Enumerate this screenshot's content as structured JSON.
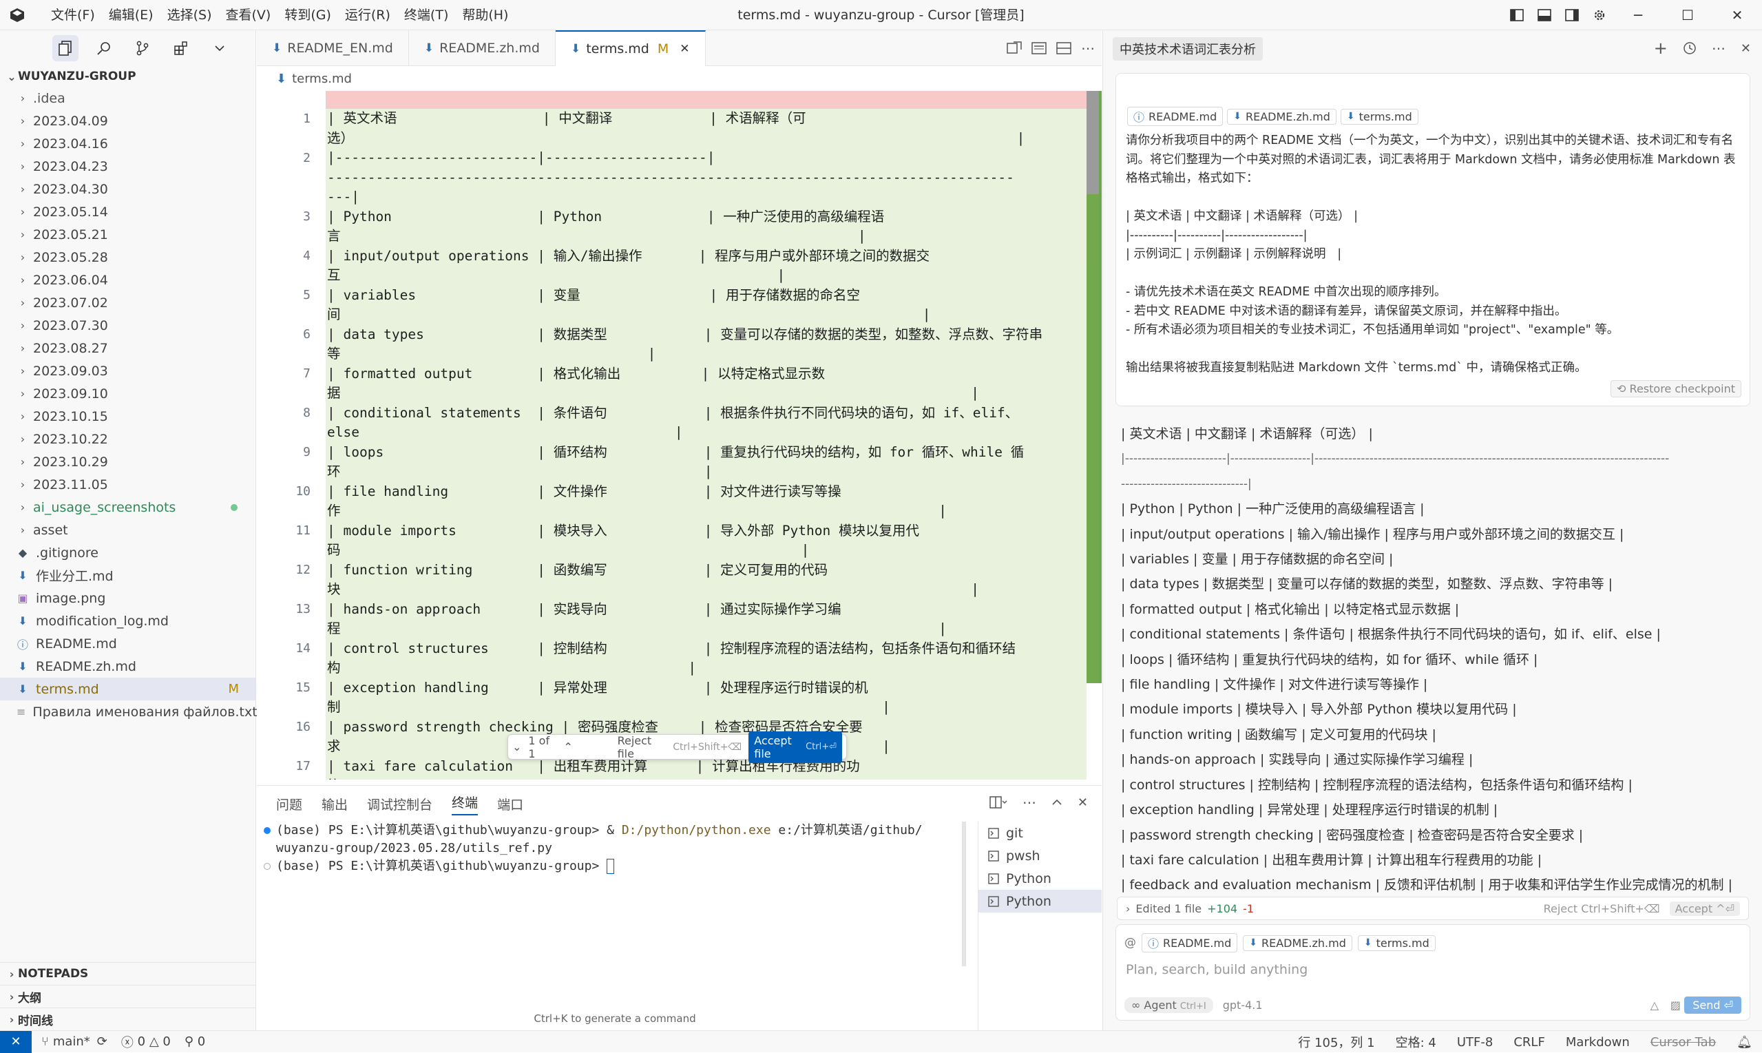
{
  "window": {
    "title": "terms.md - wuyanzu-group - Cursor [管理员]",
    "menus": [
      "文件(F)",
      "编辑(E)",
      "选择(S)",
      "查看(V)",
      "转到(G)",
      "运行(R)",
      "终端(T)",
      "帮助(H)"
    ],
    "controls": {
      "minimize": "─",
      "maximize": "☐",
      "close": "✕"
    }
  },
  "sidebar": {
    "root": "WUYANZU-GROUP",
    "items": [
      {
        "label": ".idea",
        "type": "folder"
      },
      {
        "label": "2023.04.09",
        "type": "folder"
      },
      {
        "label": "2023.04.16",
        "type": "folder"
      },
      {
        "label": "2023.04.23",
        "type": "folder"
      },
      {
        "label": "2023.04.30",
        "type": "folder"
      },
      {
        "label": "2023.05.14",
        "type": "folder"
      },
      {
        "label": "2023.05.21",
        "type": "folder"
      },
      {
        "label": "2023.05.28",
        "type": "folder"
      },
      {
        "label": "2023.06.04",
        "type": "folder"
      },
      {
        "label": "2023.07.02",
        "type": "folder"
      },
      {
        "label": "2023.07.30",
        "type": "folder"
      },
      {
        "label": "2023.08.27",
        "type": "folder"
      },
      {
        "label": "2023.09.03",
        "type": "folder"
      },
      {
        "label": "2023.09.10",
        "type": "folder"
      },
      {
        "label": "2023.10.15",
        "type": "folder"
      },
      {
        "label": "2023.10.22",
        "type": "folder"
      },
      {
        "label": "2023.10.29",
        "type": "folder"
      },
      {
        "label": "2023.11.05",
        "type": "folder"
      },
      {
        "label": "ai_usage_screenshots",
        "type": "folder"
      },
      {
        "label": "asset",
        "type": "folder"
      },
      {
        "label": ".gitignore",
        "type": "file"
      },
      {
        "label": "作业分工.md",
        "type": "file"
      },
      {
        "label": "image.png",
        "type": "file"
      },
      {
        "label": "modification_log.md",
        "type": "file"
      },
      {
        "label": "README.md",
        "type": "file"
      },
      {
        "label": "README.zh.md",
        "type": "file"
      },
      {
        "label": "terms.md",
        "type": "file",
        "badge": "M"
      },
      {
        "label": "Правила именования файлов.txt",
        "type": "file"
      }
    ],
    "sections": [
      "NOTEPADS",
      "大纲",
      "时间线"
    ],
    "colors": {
      "untracked": "#2e8b57",
      "modified": "#b58a00",
      "selected": "#e4e6f1"
    }
  },
  "tabs": [
    {
      "label": "README_EN.md",
      "modified": ""
    },
    {
      "label": "README.zh.md",
      "modified": ""
    },
    {
      "label": "terms.md",
      "modified": "M"
    }
  ],
  "breadcrumb": "terms.md",
  "editor": {
    "line_numbers": [
      "1",
      "2",
      "3",
      "4",
      "5",
      "6",
      "7",
      "8",
      "9",
      "10",
      "11",
      "12",
      "13",
      "14",
      "15",
      "16",
      "17"
    ],
    "code": "| 英文术语                  | 中文翻译            | 术语解释（可\n选）                                                                                  |\n|-------------------------|--------------------|\n-------------------------------------------------------------------------------------\n---|\n| Python                  | Python             | 一种广泛使用的高级编程语\n言                                                                |\n| input/output operations | 输入/输出操作       | 程序与用户或外部环境之间的数据交\n互                                                      |\n| variables               | 变量                | 用于存储数据的命名空\n间                                                                        |\n| data types              | 数据类型            | 变量可以存储的数据的类型，如整数、浮点数、字符串\n等                                      |\n| formatted output        | 格式化输出          | 以特定格式显示数\n据                                                                              |\n| conditional statements  | 条件语句            | 根据条件执行不同代码块的语句，如 if、elif、\nelse                                       |\n| loops                   | 循环结构            | 重复执行代码块的结构，如 for 循环、while 循\n环                                             |\n| file handling           | 文件操作            | 对文件进行读写等操\n作                                                                          |\n| module imports          | 模块导入            | 导入外部 Python 模块以复用代\n码                                                         |\n| function writing        | 函数编写            | 定义可复用的代码\n块                                                                              |\n| hands-on approach       | 实践导向            | 通过实际操作学习编\n程                                                                          |\n| control structures      | 控制结构            | 控制程序流程的语法结构，包括条件语句和循环结\n构                                           |\n| exception handling      | 异常处理            | 处理程序运行时错误的机\n制                                                                   |\n| password strength checking | 密码强度检查     | 检查密码是否符合安全要\n求                                                                   |\n| taxi fare calculation   | 出租车费用计算      | 计算出租车行程费用的功\n能                                                                   |",
    "float_bar": {
      "counter": "1 of 1",
      "reject": "Reject file",
      "reject_key": "Ctrl+Shift+⌫",
      "accept": "Accept file",
      "accept_key": "Ctrl+⏎"
    }
  },
  "panel": {
    "tabs": [
      "问题",
      "输出",
      "调试控制台",
      "终端",
      "端口"
    ],
    "active_tab": "终端",
    "terminal": {
      "line1_prompt": "(base) PS E:\\计算机英语\\github\\wuyanzu-group> & ",
      "line1_path": "D:/python/python.exe",
      "line1_rest": " e:/计算机英语/github/",
      "line2": "wuyanzu-group/2023.05.28/utils_ref.py",
      "line3": "(base) PS E:\\计算机英语\\github\\wuyanzu-group> "
    },
    "terminal_list": [
      "git",
      "pwsh",
      "Python",
      "Python"
    ],
    "hint": "Ctrl+K to generate a command"
  },
  "chat": {
    "title": "中英技术术语词汇表分析",
    "context_pills": [
      "README.md",
      "README.zh.md",
      "terms.md"
    ],
    "prompt": "请你分析我项目中的两个 README 文档（一个为英文，一个为中文），识别出其中的关键术语、技术词汇和专有名词。将它们整理为一个中英对照的术语词汇表，词汇表将用于 Markdown 文档中，请务必使用标准 Markdown 表格格式输出，格式如下：\n\n| 英文术语 | 中文翻译 | 术语解释（可选） |\n|----------|----------|------------------|\n| 示例词汇 | 示例翻译 | 示例解释说明   |\n\n- 请优先技术术语在英文 README 中首次出现的顺序排列。\n- 若中文 README 中对该术语的翻译有差异，请保留英文原词，并在解释中指出。\n- 所有术语必须为项目相关的专业技术词汇，不包括通用单词如 \"project\"、\"example\" 等。\n\n输出结果将被我直接复制粘贴进 Markdown 文件 `terms.md` 中，请确保格式正确。",
    "restore": "Restore checkpoint",
    "answer_header": "| 英文术语 | 中文翻译 | 术语解释（可选） |",
    "answer_sep1": "|------------------------|-------------------|------------------------------------------------------------------------------------",
    "answer_sep2": "------------------------------|",
    "answer_rows": [
      "| Python | Python | 一种广泛使用的高级编程语言 |",
      "| input/output operations | 输入/输出操作 | 程序与用户或外部环境之间的数据交互 |",
      "| variables | 变量 | 用于存储数据的命名空间 |",
      "| data types | 数据类型 | 变量可以存储的数据的类型，如整数、浮点数、字符串等 |",
      "| formatted output | 格式化输出 | 以特定格式显示数据 |",
      "| conditional statements | 条件语句 | 根据条件执行不同代码块的语句，如 if、elif、else |",
      "| loops | 循环结构 | 重复执行代码块的结构，如 for 循环、while 循环 |",
      "| file handling | 文件操作 | 对文件进行读写等操作 |",
      "| module imports | 模块导入 | 导入外部 Python 模块以复用代码 |",
      "| function writing | 函数编写 | 定义可复用的代码块 |",
      "| hands-on approach | 实践导向 | 通过实际操作学习编程 |",
      "| control structures | 控制结构 | 控制程序流程的语法结构，包括条件语句和循环结构 |",
      "| exception handling | 异常处理 | 处理程序运行时错误的机制 |",
      "| password strength checking | 密码强度检查 | 检查密码是否符合安全要求 |",
      "| taxi fare calculation | 出租车费用计算 | 计算出租车行程费用的功能 |",
      "| feedback and evaluation mechanism | 反馈和评估机制 | 用于收集和评估学生作业完成情况的机制 |"
    ],
    "edited": {
      "label": "Edited 1 file",
      "added": "+104",
      "removed": "-1",
      "reject": "Reject Ctrl+Shift+⌫",
      "accept": "Accept ^⏎"
    },
    "input": {
      "pills": [
        "README.md",
        "README.zh.md",
        "terms.md"
      ],
      "placeholder": "Plan, search, build anything",
      "agent": "∞ Agent",
      "agent_key": "Ctrl+I",
      "model": "gpt-4.1",
      "send": "Send ⏎"
    }
  },
  "status": {
    "branch": "main*",
    "errors": "0",
    "warnings": "0",
    "ports": "0",
    "position": "行 105，列 1",
    "spaces": "空格: 4",
    "encoding": "UTF-8",
    "eol": "CRLF",
    "language": "Markdown",
    "cursor_tab": "Cursor Tab"
  }
}
